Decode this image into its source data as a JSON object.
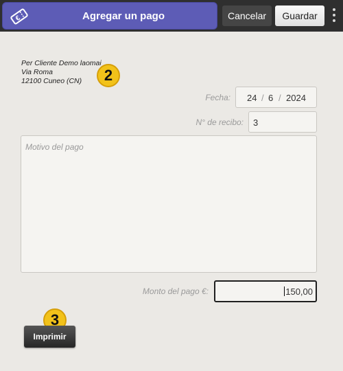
{
  "header": {
    "title": "Agregar un pago",
    "cancel_label": "Cancelar",
    "save_label": "Guardar",
    "icon": "euro-ticket-icon",
    "accent_color": "#5d5cb6"
  },
  "client": {
    "name": "Per Cliente Demo laomai",
    "street": "Via Roma",
    "city": "12100 Cuneo (CN)"
  },
  "markers": {
    "first": "2",
    "second": "3"
  },
  "form": {
    "date_label": "Fecha:",
    "date_day": "24",
    "date_month": "6",
    "date_year": "2024",
    "date_sep": "/",
    "receipt_label": "N° de recibo:",
    "receipt_value": "3",
    "reason_placeholder": "Motivo del pago",
    "amount_label": "Monto del pago €:",
    "amount_value": "150,00"
  },
  "actions": {
    "print_label": "Imprimir"
  }
}
